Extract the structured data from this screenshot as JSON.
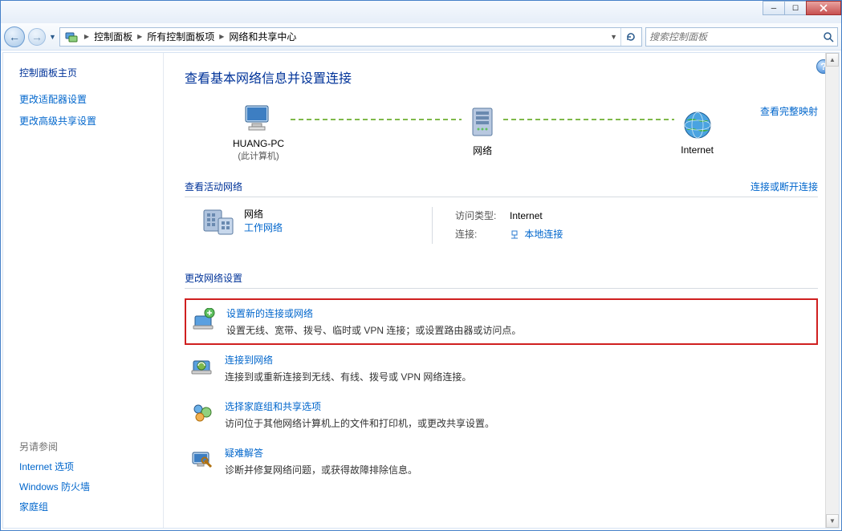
{
  "titlebar": {
    "minimize": "─",
    "maximize": "☐",
    "close": "✕"
  },
  "breadcrumb": {
    "items": [
      "控制面板",
      "所有控制面板项",
      "网络和共享中心"
    ]
  },
  "search": {
    "placeholder": "搜索控制面板"
  },
  "sidebar": {
    "home": "控制面板主页",
    "links": [
      "更改适配器设置",
      "更改高级共享设置"
    ],
    "see_also_hdr": "另请参阅",
    "see_also": [
      "Internet 选项",
      "Windows 防火墙",
      "家庭组"
    ]
  },
  "page": {
    "title": "查看基本网络信息并设置连接",
    "full_map_link": "查看完整映射",
    "nodes": {
      "pc": "HUANG-PC",
      "pc_sub": "(此计算机)",
      "net": "网络",
      "internet": "Internet"
    },
    "active_hdr": "查看活动网络",
    "active_hdr_link": "连接或断开连接",
    "active_net": {
      "name": "网络",
      "type": "工作网络",
      "access_k": "访问类型:",
      "access_v": "Internet",
      "conn_k": "连接:",
      "conn_v": "本地连接"
    },
    "change_hdr": "更改网络设置",
    "settings": [
      {
        "link": "设置新的连接或网络",
        "desc": "设置无线、宽带、拨号、临时或 VPN 连接；或设置路由器或访问点。",
        "highlighted": true
      },
      {
        "link": "连接到网络",
        "desc": "连接到或重新连接到无线、有线、拨号或 VPN 网络连接。",
        "highlighted": false
      },
      {
        "link": "选择家庭组和共享选项",
        "desc": "访问位于其他网络计算机上的文件和打印机，或更改共享设置。",
        "highlighted": false
      },
      {
        "link": "疑难解答",
        "desc": "诊断并修复网络问题，或获得故障排除信息。",
        "highlighted": false
      }
    ]
  }
}
